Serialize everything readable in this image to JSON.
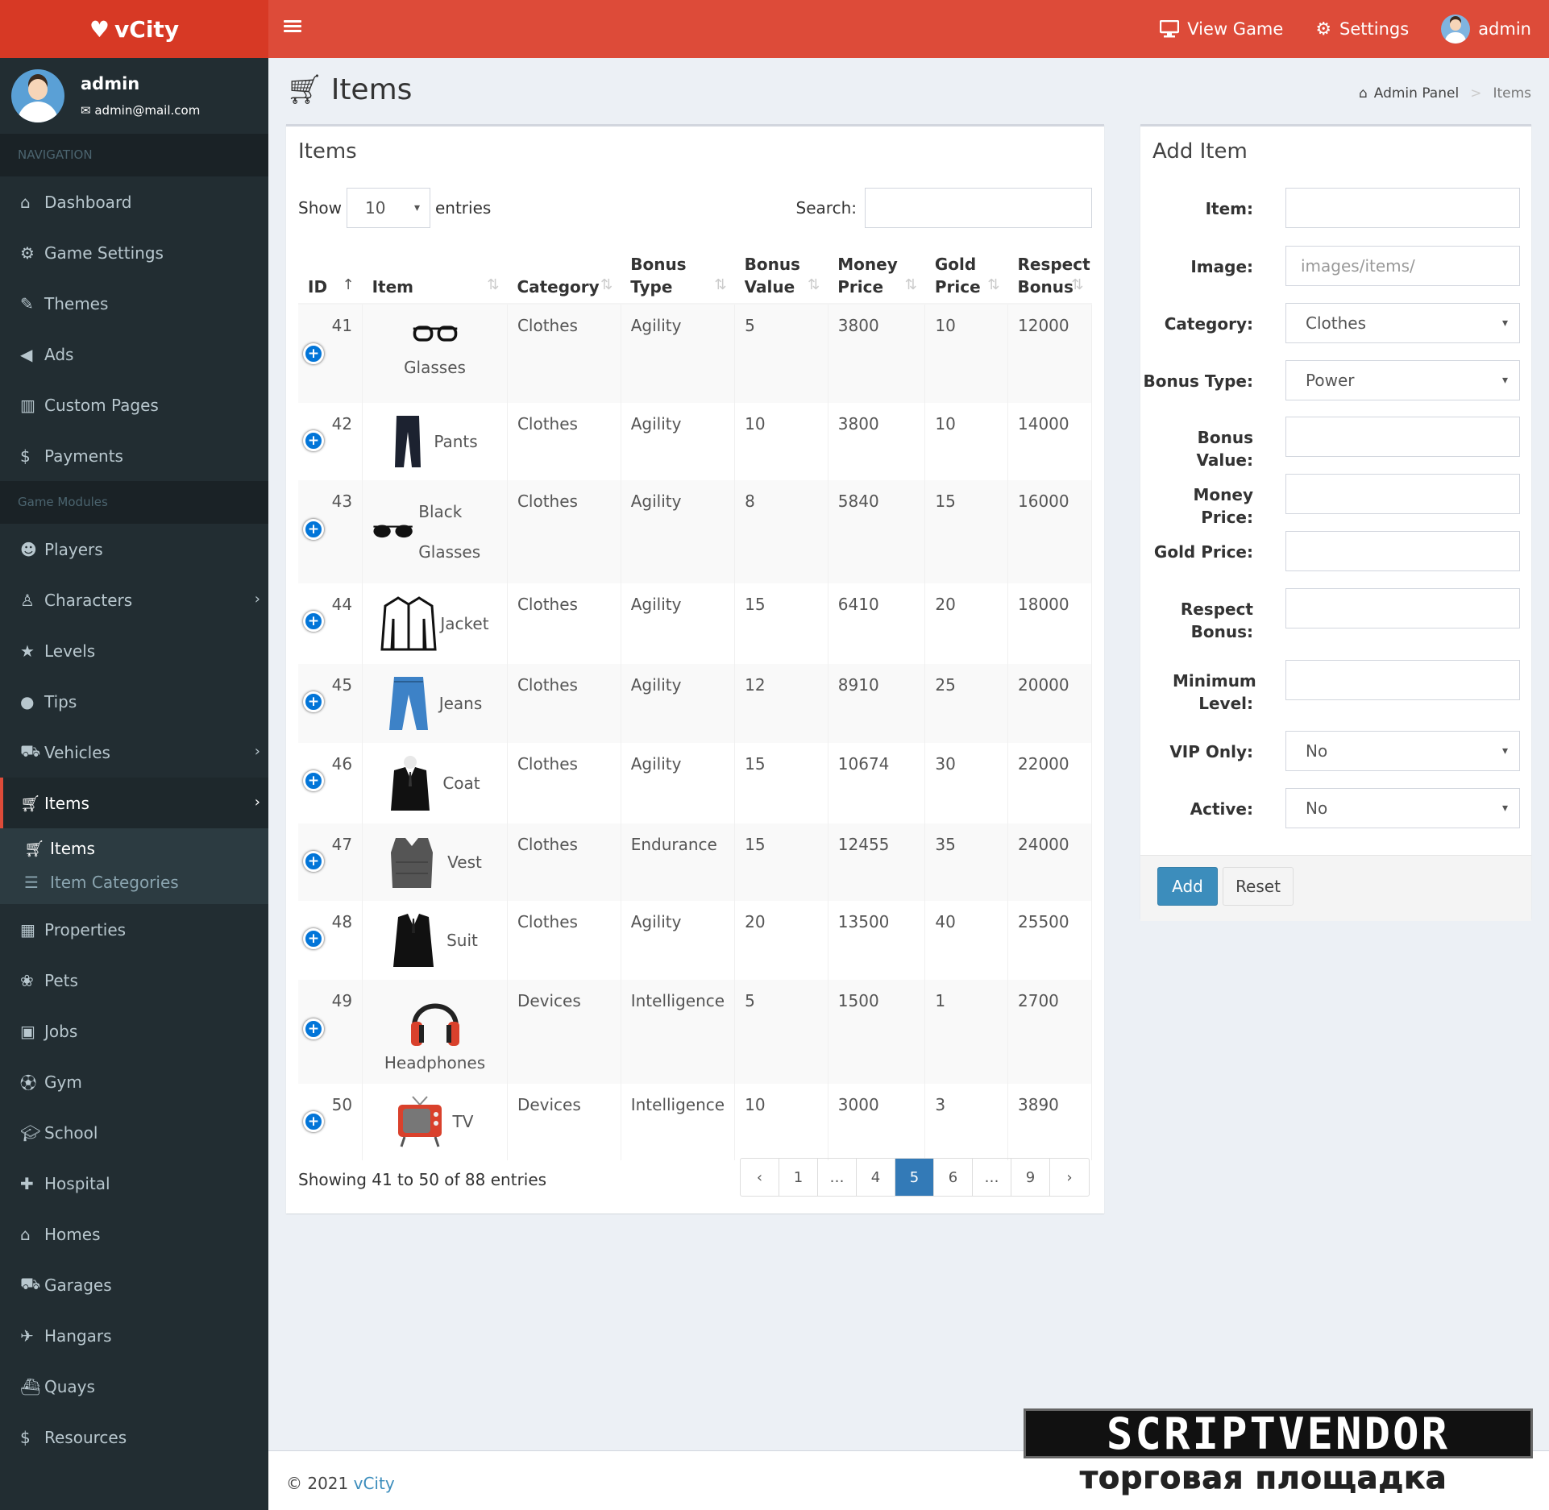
{
  "brand": {
    "name": "vCity"
  },
  "topnav": {
    "view_game": "View Game",
    "settings": "Settings",
    "user": "admin"
  },
  "user_panel": {
    "name": "admin",
    "email": "admin@mail.com"
  },
  "sidebar": {
    "nav_header": "NAVIGATION",
    "nav_items": [
      {
        "label": "Dashboard",
        "icon": "home-icon"
      },
      {
        "label": "Game Settings",
        "icon": "cogs-icon"
      },
      {
        "label": "Themes",
        "icon": "brush-icon"
      },
      {
        "label": "Ads",
        "icon": "bullhorn-icon"
      },
      {
        "label": "Custom Pages",
        "icon": "columns-icon"
      },
      {
        "label": "Payments",
        "icon": "dollar-icon"
      }
    ],
    "modules_header": "Game Modules",
    "module_items": [
      {
        "label": "Players",
        "icon": "users-icon"
      },
      {
        "label": "Characters",
        "icon": "child-icon"
      },
      {
        "label": "Levels",
        "icon": "star-icon"
      },
      {
        "label": "Tips",
        "icon": "lightbulb-icon"
      },
      {
        "label": "Vehicles",
        "icon": "car-icon"
      },
      {
        "label": "Items",
        "icon": "cart-icon"
      }
    ],
    "items_sub": [
      {
        "label": "Items",
        "icon": "cart-icon"
      },
      {
        "label": "Item Categories",
        "icon": "list-icon"
      }
    ],
    "module_items_2": [
      {
        "label": "Properties",
        "icon": "building-icon"
      },
      {
        "label": "Pets",
        "icon": "paw-icon"
      },
      {
        "label": "Jobs",
        "icon": "briefcase-icon"
      },
      {
        "label": "Gym",
        "icon": "futbol-icon"
      },
      {
        "label": "School",
        "icon": "graduation-cap-icon"
      },
      {
        "label": "Hospital",
        "icon": "hospital-icon"
      },
      {
        "label": "Homes",
        "icon": "home-icon"
      },
      {
        "label": "Garages",
        "icon": "car-icon"
      },
      {
        "label": "Hangars",
        "icon": "plane-icon"
      },
      {
        "label": "Quays",
        "icon": "ship-icon"
      },
      {
        "label": "Resources",
        "icon": "dollar-icon"
      }
    ]
  },
  "page": {
    "title": "Items",
    "breadcrumb_home": "Admin Panel",
    "breadcrumb_current": "Items"
  },
  "items_box": {
    "title": "Items",
    "show_label": "Show",
    "entries_value": "10",
    "entries_label": "entries",
    "search_label": "Search:",
    "columns": [
      "ID",
      "Item",
      "Category",
      "Bonus Type",
      "Bonus Value",
      "Money Price",
      "Gold Price",
      "Respect Bonus"
    ],
    "rows": [
      {
        "id": "41",
        "item": "Glasses",
        "category": "Clothes",
        "bonus_type": "Agility",
        "bonus_value": "5",
        "money_price": "3800",
        "gold_price": "10",
        "respect_bonus": "12000"
      },
      {
        "id": "42",
        "item": "Pants",
        "category": "Clothes",
        "bonus_type": "Agility",
        "bonus_value": "10",
        "money_price": "3800",
        "gold_price": "10",
        "respect_bonus": "14000"
      },
      {
        "id": "43",
        "item": "Black Glasses",
        "category": "Clothes",
        "bonus_type": "Agility",
        "bonus_value": "8",
        "money_price": "5840",
        "gold_price": "15",
        "respect_bonus": "16000"
      },
      {
        "id": "44",
        "item": "Jacket",
        "category": "Clothes",
        "bonus_type": "Agility",
        "bonus_value": "15",
        "money_price": "6410",
        "gold_price": "20",
        "respect_bonus": "18000"
      },
      {
        "id": "45",
        "item": "Jeans",
        "category": "Clothes",
        "bonus_type": "Agility",
        "bonus_value": "12",
        "money_price": "8910",
        "gold_price": "25",
        "respect_bonus": "20000"
      },
      {
        "id": "46",
        "item": "Coat",
        "category": "Clothes",
        "bonus_type": "Agility",
        "bonus_value": "15",
        "money_price": "10674",
        "gold_price": "30",
        "respect_bonus": "22000"
      },
      {
        "id": "47",
        "item": "Vest",
        "category": "Clothes",
        "bonus_type": "Endurance",
        "bonus_value": "15",
        "money_price": "12455",
        "gold_price": "35",
        "respect_bonus": "24000"
      },
      {
        "id": "48",
        "item": "Suit",
        "category": "Clothes",
        "bonus_type": "Agility",
        "bonus_value": "20",
        "money_price": "13500",
        "gold_price": "40",
        "respect_bonus": "25500"
      },
      {
        "id": "49",
        "item": "Headphones",
        "category": "Devices",
        "bonus_type": "Intelligence",
        "bonus_value": "5",
        "money_price": "1500",
        "gold_price": "1",
        "respect_bonus": "2700"
      },
      {
        "id": "50",
        "item": "TV",
        "category": "Devices",
        "bonus_type": "Intelligence",
        "bonus_value": "10",
        "money_price": "3000",
        "gold_price": "3",
        "respect_bonus": "3890"
      }
    ],
    "info": "Showing 41 to 50 of 88 entries",
    "pager": [
      "‹",
      "1",
      "…",
      "4",
      "5",
      "6",
      "…",
      "9",
      "›"
    ]
  },
  "add_box": {
    "title": "Add Item",
    "fields": {
      "item": {
        "label": "Item:",
        "value": ""
      },
      "image": {
        "label": "Image:",
        "placeholder": "images/items/"
      },
      "category": {
        "label": "Category:",
        "value": "Clothes"
      },
      "bonus_type": {
        "label": "Bonus Type:",
        "value": "Power"
      },
      "bonus_value": {
        "label": "Bonus Value:",
        "value": ""
      },
      "money_price": {
        "label": "Money Price:",
        "value": ""
      },
      "gold_price": {
        "label": "Gold Price:",
        "value": ""
      },
      "respect_bonus": {
        "label": "Respect Bonus:",
        "value": ""
      },
      "minimum_level": {
        "label": "Minimum Level:",
        "value": ""
      },
      "vip_only": {
        "label": "VIP Only:",
        "value": "No"
      },
      "active": {
        "label": "Active:",
        "value": "No"
      }
    },
    "add_label": "Add",
    "reset_label": "Reset"
  },
  "footer": {
    "copyright": "© 2021",
    "brand": "vCity"
  },
  "watermark": {
    "top": "SCRIPTVENDOR",
    "bottom": "торговая площадка"
  },
  "colors": {
    "header": "#dd4b39",
    "logo": "#d73925",
    "sidebar": "#222d32",
    "primary": "#3c8dbc"
  }
}
